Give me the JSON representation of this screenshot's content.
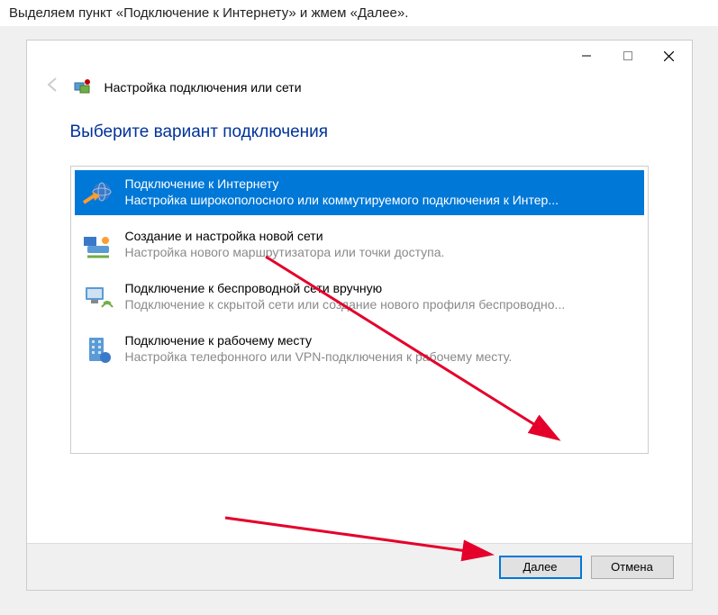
{
  "caption": "Выделяем пункт «Подключение к Интернету» и жмем «Далее».",
  "header": {
    "title": "Настройка подключения или сети"
  },
  "heading": "Выберите вариант подключения",
  "options": [
    {
      "icon": "globe-arrow-icon",
      "title": "Подключение к Интернету",
      "desc": "Настройка широкополосного или коммутируемого подключения к Интер...",
      "selected": true
    },
    {
      "icon": "router-icon",
      "title": "Создание и настройка новой сети",
      "desc": "Настройка нового маршрутизатора или точки доступа.",
      "selected": false
    },
    {
      "icon": "wireless-monitor-icon",
      "title": "Подключение к беспроводной сети вручную",
      "desc": "Подключение к скрытой сети или создание нового профиля беспроводно...",
      "selected": false
    },
    {
      "icon": "workplace-icon",
      "title": "Подключение к рабочему месту",
      "desc": "Настройка телефонного или VPN-подключения к рабочему месту.",
      "selected": false
    }
  ],
  "buttons": {
    "next": "Далее",
    "cancel": "Отмена"
  }
}
